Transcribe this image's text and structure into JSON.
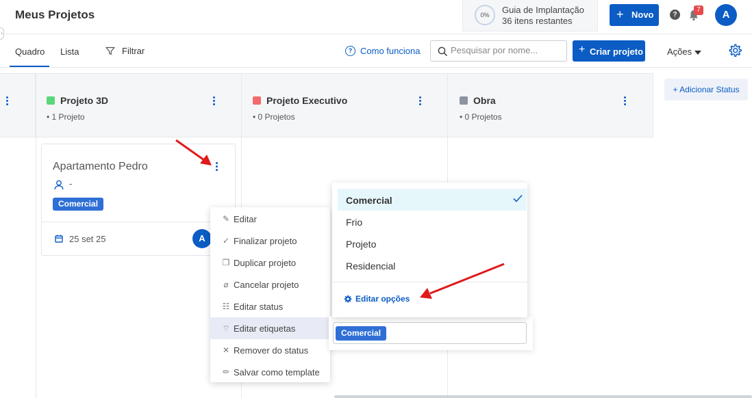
{
  "header": {
    "title": "Meus Projetos",
    "guide": {
      "percent": "0%",
      "title": "Guia de Implantação",
      "subtitle": "36 itens restantes"
    },
    "new_button": "Novo",
    "help_icon": "?",
    "notifications_count": "7",
    "avatar_initial": "A"
  },
  "toolbar": {
    "tabs": [
      {
        "label": "Quadro",
        "active": true
      },
      {
        "label": "Lista",
        "active": false
      }
    ],
    "filter_label": "Filtrar",
    "how_works": "Como funciona",
    "search_placeholder": "Pesquisar por nome...",
    "create_button": "Criar projeto",
    "actions_label": "Ações"
  },
  "columns": [
    {
      "name": "Projeto 3D",
      "count": "1 Projeto",
      "color": "#5cd67b"
    },
    {
      "name": "Projeto Executivo",
      "count": "0 Projetos",
      "color": "#f36a6a"
    },
    {
      "name": "Obra",
      "count": "0 Projetos",
      "color": "#8c93a3"
    }
  ],
  "add_status": "+ Adicionar Status",
  "card": {
    "title": "Apartamento Pedro",
    "responsible": "-",
    "tag": "Comercial",
    "date": "25 set 25",
    "avatar_initial": "A"
  },
  "context_menu": {
    "items": [
      {
        "label": "Editar",
        "icon": "edit-icon"
      },
      {
        "label": "Finalizar projeto",
        "icon": "check-icon"
      },
      {
        "label": "Duplicar projeto",
        "icon": "copy-icon"
      },
      {
        "label": "Cancelar projeto",
        "icon": "cancel-icon"
      },
      {
        "label": "Editar status",
        "icon": "status-icon"
      },
      {
        "label": "Editar etiquetas",
        "icon": "tag-icon",
        "active": true
      },
      {
        "label": "Remover do status",
        "icon": "close-icon"
      },
      {
        "label": "Salvar como template",
        "icon": "pencil-icon"
      }
    ]
  },
  "tag_dropdown": {
    "options": [
      {
        "label": "Comercial",
        "selected": true
      },
      {
        "label": "Frio",
        "selected": false
      },
      {
        "label": "Projeto",
        "selected": false
      },
      {
        "label": "Residencial",
        "selected": false
      }
    ],
    "edit_options": "Editar opções",
    "selected_chip": "Comercial"
  },
  "colors": {
    "accent": "#0b5cc4",
    "tag": "#2f6fd6",
    "annotation_arrow": "#e0191b"
  }
}
